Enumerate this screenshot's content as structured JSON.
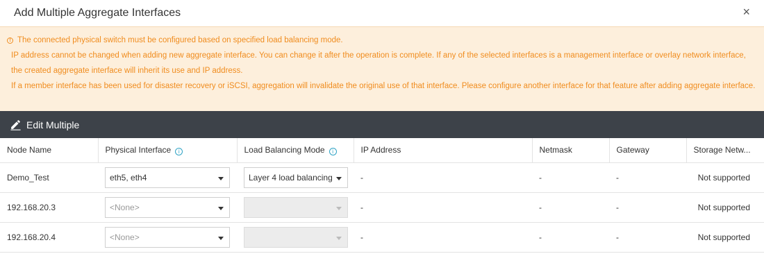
{
  "dialog": {
    "title": "Add Multiple Aggregate Interfaces",
    "close_glyph": "×"
  },
  "notice": {
    "line1": "The connected physical switch must be configured based on specified load balancing mode.",
    "line2": "IP address cannot be changed when adding new aggregate interface. You can change it after the operation is complete. If any of the selected interfaces is a management interface or overlay network interface, the created aggregate interface will inherit its use and IP address.",
    "line3": "If a member interface has been used for disaster recovery or iSCSI, aggregation will invalidate the original use of that interface. Please configure another interface for that feature after adding aggregate interface.",
    "color": "#f08c1e"
  },
  "toolbar": {
    "edit_label": "Edit Multiple",
    "background": "#3d4249"
  },
  "table": {
    "headers": {
      "node": "Node Name",
      "physical": "Physical Interface",
      "lb": "Load Balancing Mode",
      "ip": "IP Address",
      "netmask": "Netmask",
      "gateway": "Gateway",
      "storage": "Storage Netw..."
    },
    "rows": [
      {
        "node": "Demo_Test",
        "physical": "eth5, eth4",
        "lb": "Layer 4 load balancing",
        "ip": "-",
        "netmask": "-",
        "gateway": "-",
        "storage": "Not supported"
      },
      {
        "node": "192.168.20.3",
        "physical": "<None>",
        "lb": "",
        "ip": "-",
        "netmask": "-",
        "gateway": "-",
        "storage": "Not supported"
      },
      {
        "node": "192.168.20.4",
        "physical": "<None>",
        "lb": "",
        "ip": "-",
        "netmask": "-",
        "gateway": "-",
        "storage": "Not supported"
      }
    ]
  },
  "icons": {
    "warning": "warning-circle-icon",
    "info": "info-circle-icon",
    "edit": "pencil-icon",
    "dropdown": "chevron-down-icon"
  }
}
